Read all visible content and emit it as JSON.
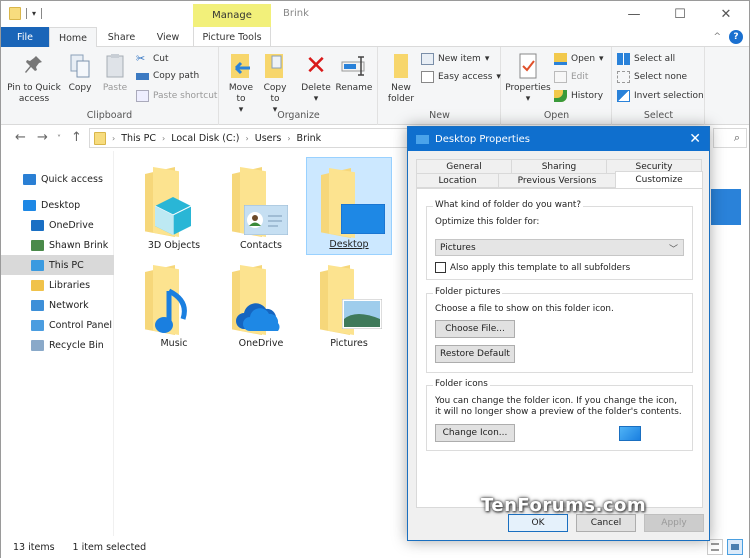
{
  "window": {
    "title": "Brink",
    "contextual_tab": "Manage",
    "controls": {
      "minimize": "—",
      "maximize": "☐",
      "close": "✕"
    }
  },
  "ribbon_tabs": [
    "File",
    "Home",
    "Share",
    "View",
    "Picture Tools"
  ],
  "ribbon": {
    "clipboard": {
      "label": "Clipboard",
      "pin": "Pin to Quick access",
      "copy": "Copy",
      "paste": "Paste",
      "cut": "Cut",
      "copy_path": "Copy path",
      "paste_shortcut": "Paste shortcut"
    },
    "organize": {
      "label": "Organize",
      "move_to": "Move to",
      "copy_to": "Copy to",
      "delete": "Delete",
      "rename": "Rename"
    },
    "new": {
      "label": "New",
      "new_folder": "New folder",
      "new_item": "New item",
      "easy_access": "Easy access"
    },
    "open": {
      "label": "Open",
      "properties": "Properties",
      "open": "Open",
      "edit": "Edit",
      "history": "History"
    },
    "select": {
      "label": "Select",
      "select_all": "Select all",
      "select_none": "Select none",
      "invert": "Invert selection"
    }
  },
  "address": {
    "crumbs": [
      "This PC",
      "Local Disk (C:)",
      "Users",
      "Brink"
    ]
  },
  "sidebar": [
    {
      "label": "Quick access",
      "icon": "star-icon",
      "color": "#2a7fd4"
    },
    {
      "label": "Desktop",
      "icon": "desktop-icon",
      "color": "#1e88e5"
    },
    {
      "label": "OneDrive",
      "icon": "cloud-icon",
      "color": "#1a6fc4"
    },
    {
      "label": "Shawn Brink",
      "icon": "user-icon",
      "color": "#4a8a4a"
    },
    {
      "label": "This PC",
      "icon": "computer-icon",
      "color": "#3a9ae0",
      "selected": true
    },
    {
      "label": "Libraries",
      "icon": "library-icon",
      "color": "#f0c24a"
    },
    {
      "label": "Network",
      "icon": "network-icon",
      "color": "#3d8fd8"
    },
    {
      "label": "Control Panel",
      "icon": "control-panel-icon",
      "color": "#4b9de0"
    },
    {
      "label": "Recycle Bin",
      "icon": "recycle-bin-icon",
      "color": "#8aa9c9"
    }
  ],
  "folders": [
    {
      "label": "3D Objects",
      "overlay": "cube"
    },
    {
      "label": "Contacts",
      "overlay": "contact-card"
    },
    {
      "label": "Desktop",
      "overlay": "desktop-screen",
      "selected": true
    },
    {
      "label": "Music",
      "overlay": "music-note"
    },
    {
      "label": "OneDrive",
      "overlay": "cloud"
    },
    {
      "label": "Pictures",
      "overlay": "landscape"
    }
  ],
  "status": {
    "count": "13 items",
    "selected": "1 item selected"
  },
  "dialog": {
    "title": "Desktop Properties",
    "tabs_row1": [
      "General",
      "Sharing",
      "Security"
    ],
    "tabs_row2": [
      "Location",
      "Previous Versions",
      "Customize"
    ],
    "active_tab": "Customize",
    "group1": {
      "title": "What kind of folder do you want?",
      "optimize_label": "Optimize this folder for:",
      "optimize_value": "Pictures",
      "apply_subfolders": "Also apply this template to all subfolders",
      "apply_checked": false
    },
    "group2": {
      "title": "Folder pictures",
      "text": "Choose a file to show on this folder icon.",
      "choose_file": "Choose File...",
      "restore_default": "Restore Default"
    },
    "group3": {
      "title": "Folder icons",
      "text": "You can change the folder icon. If you change the icon, it will no longer show a preview of the folder's contents.",
      "change_icon": "Change Icon..."
    },
    "buttons": {
      "ok": "OK",
      "cancel": "Cancel",
      "apply": "Apply"
    }
  },
  "watermark": "TenForums.com",
  "colors": {
    "accent": "#0f6fce",
    "file_tab": "#1a65b8",
    "manage": "#f2f07a",
    "selection": "#cce8ff"
  }
}
